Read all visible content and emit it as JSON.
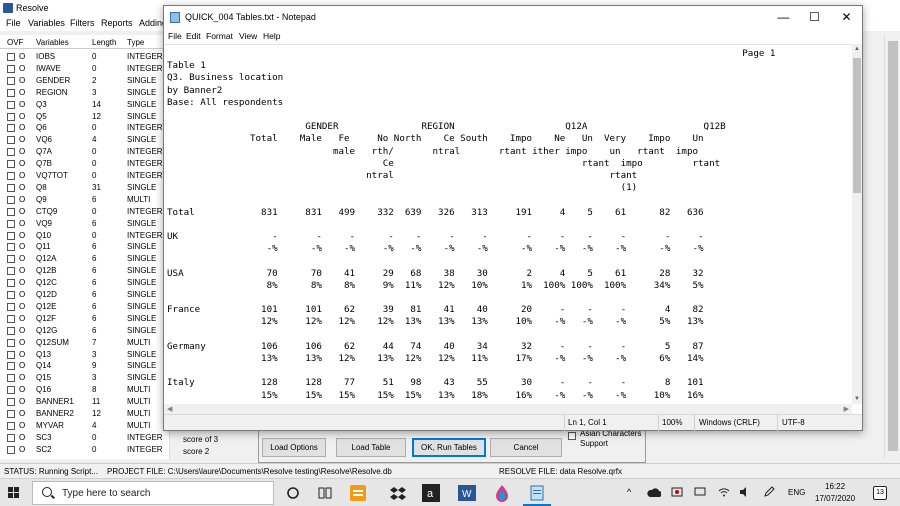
{
  "resolve": {
    "title": "Resolve",
    "menu": [
      "File",
      "Variables",
      "Filters",
      "Reports",
      "Adding"
    ],
    "grid_headers": [
      "OVF",
      "Variables",
      "Length",
      "Type"
    ],
    "rows": [
      {
        "ovf": "O",
        "var": "IOBS",
        "len": "0",
        "type": "INTEGER"
      },
      {
        "ovf": "O",
        "var": "IWAVE",
        "len": "0",
        "type": "INTEGER"
      },
      {
        "ovf": "O",
        "var": "GENDER",
        "len": "2",
        "type": "SINGLE"
      },
      {
        "ovf": "O",
        "var": "REGION",
        "len": "3",
        "type": "SINGLE"
      },
      {
        "ovf": "O",
        "var": "Q3",
        "len": "14",
        "type": "SINGLE"
      },
      {
        "ovf": "O",
        "var": "Q5",
        "len": "12",
        "type": "SINGLE"
      },
      {
        "ovf": "O",
        "var": "Q6",
        "len": "0",
        "type": "INTEGER"
      },
      {
        "ovf": "O",
        "var": "VQ6",
        "len": "4",
        "type": "SINGLE"
      },
      {
        "ovf": "O",
        "var": "Q7A",
        "len": "0",
        "type": "INTEGER"
      },
      {
        "ovf": "O",
        "var": "Q7B",
        "len": "0",
        "type": "INTEGER"
      },
      {
        "ovf": "O",
        "var": "VQ7TOT",
        "len": "0",
        "type": "INTEGER"
      },
      {
        "ovf": "O",
        "var": "Q8",
        "len": "31",
        "type": "SINGLE"
      },
      {
        "ovf": "O",
        "var": "Q9",
        "len": "6",
        "type": "MULTI"
      },
      {
        "ovf": "O",
        "var": "CTQ9",
        "len": "0",
        "type": "INTEGER"
      },
      {
        "ovf": "O",
        "var": "VQ9",
        "len": "6",
        "type": "SINGLE"
      },
      {
        "ovf": "O",
        "var": "Q10",
        "len": "0",
        "type": "INTEGER"
      },
      {
        "ovf": "O",
        "var": "Q11",
        "len": "6",
        "type": "SINGLE"
      },
      {
        "ovf": "O",
        "var": "Q12A",
        "len": "6",
        "type": "SINGLE"
      },
      {
        "ovf": "O",
        "var": "Q12B",
        "len": "6",
        "type": "SINGLE"
      },
      {
        "ovf": "O",
        "var": "Q12C",
        "len": "6",
        "type": "SINGLE"
      },
      {
        "ovf": "O",
        "var": "Q12D",
        "len": "6",
        "type": "SINGLE"
      },
      {
        "ovf": "O",
        "var": "Q12E",
        "len": "6",
        "type": "SINGLE"
      },
      {
        "ovf": "O",
        "var": "Q12F",
        "len": "6",
        "type": "SINGLE"
      },
      {
        "ovf": "O",
        "var": "Q12G",
        "len": "6",
        "type": "SINGLE"
      },
      {
        "ovf": "O",
        "var": "Q12SUM",
        "len": "7",
        "type": "MULTI"
      },
      {
        "ovf": "O",
        "var": "Q13",
        "len": "3",
        "type": "SINGLE"
      },
      {
        "ovf": "O",
        "var": "Q14",
        "len": "9",
        "type": "SINGLE"
      },
      {
        "ovf": "O",
        "var": "Q15",
        "len": "3",
        "type": "SINGLE"
      },
      {
        "ovf": "O",
        "var": "Q16",
        "len": "8",
        "type": "MULTI"
      },
      {
        "ovf": "O",
        "var": "BANNER1",
        "len": "11",
        "type": "MULTI"
      },
      {
        "ovf": "O",
        "var": "BANNER2",
        "len": "12",
        "type": "MULTI"
      },
      {
        "ovf": "O",
        "var": "MYVAR",
        "len": "4",
        "type": "MULTI"
      },
      {
        "ovf": "O",
        "var": "SC3",
        "len": "0",
        "type": "INTEGER"
      },
      {
        "ovf": "O",
        "var": "SC2",
        "len": "0",
        "type": "INTEGER"
      }
    ],
    "side_notes": [
      "score of 3",
      "score 2"
    ],
    "buttons": {
      "load_options": "Load Options",
      "load_table": "Load Table",
      "ok_run": "OK, Run Tables",
      "cancel": "Cancel"
    },
    "asian_chars": "Asian Characters Support",
    "status": {
      "status": "STATUS:  Running Script...",
      "project": "PROJECT FILE:  C:\\Users\\laure\\Documents\\Resolve testing\\Resolve\\Resolve.db",
      "resolve_file": "RESOLVE FILE:  data Resolve.qrfx"
    }
  },
  "notepad": {
    "title": "QUICK_004 Tables.txt - Notepad",
    "controls": {
      "min": "—",
      "max": "☐",
      "close": "✕"
    },
    "menu": [
      "File",
      "Edit",
      "Format",
      "View",
      "Help"
    ],
    "content": [
      "                                                                                                        Page 1",
      "Table 1",
      "Q3. Business location",
      "by Banner2",
      "Base: All respondents",
      "",
      "                         GENDER               REGION                    Q12A                     Q12B",
      "               Total    Male   Fe     No North    Ce South    Impo    Ne   Un  Very    Impo    Un",
      "                              male   rth/       ntral       rtant ither impo    un   rtant  impo",
      "                                       Ce                                  rtant  impo         rtant",
      "                                    ntral                                       rtant",
      "                                                                                  (1)",
      "",
      "Total            831     831   499    332  639   326   313     191     4    5    61      82   636",
      "",
      "UK                 -       -     -      -    -     -     -       -     -    -     -       -     -",
      "                  -%      -%    -%     -%   -%    -%    -%      -%    -%   -%    -%      -%    -%",
      "",
      "USA               70      70    41     29   68    38    30       2     4    5    61      28    32",
      "                  8%      8%    8%     9%  11%   12%   10%      1%  100% 100%  100%     34%    5%",
      "",
      "France           101     101    62     39   81    41    40      20     -    -     -       4    82",
      "                 12%     12%   12%    12%  13%   13%   13%     10%    -%   -%    -%      5%   13%",
      "",
      "Germany          106     106    62     44   74    40    34      32     -    -     -       5    87",
      "                 13%     13%   12%    13%  12%   12%   11%     17%    -%   -%    -%      6%   14%",
      "",
      "Italy            128     128    77     51   98    43    55      30     -    -     -       8   101",
      "                 15%     15%   15%    15%  15%   13%   18%     16%    -%   -%    -%     10%   16%"
    ],
    "status": {
      "position": "Ln 1, Col 1",
      "zoom": "100%",
      "eol": "Windows (CRLF)",
      "encoding": "UTF-8"
    }
  },
  "taskbar": {
    "search_placeholder": "Type here to search",
    "language": "ENG",
    "time": "16:22",
    "date": "17/07/2020",
    "notifications": "13"
  }
}
